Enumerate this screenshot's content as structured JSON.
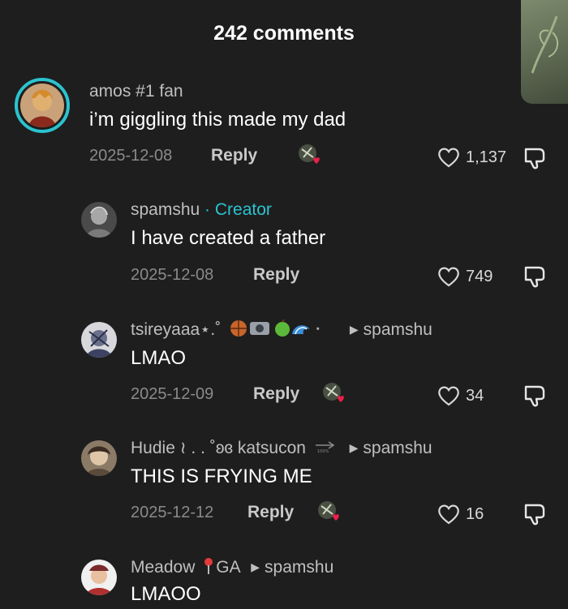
{
  "header": {
    "title": "242 comments"
  },
  "comments": [
    {
      "username": "amos #1 fan",
      "text": "i’m giggling this made my dad",
      "date": "2025-12-08",
      "reply_label": "Reply",
      "likes": "1,137"
    },
    {
      "username": "spamshu",
      "creator_sep": " · ",
      "creator_label": "Creator",
      "text": "I have created a father",
      "date": "2025-12-08",
      "reply_label": "Reply",
      "likes": "749"
    },
    {
      "username": "tsireyaaa⋆.˚",
      "reply_to": "spamshu",
      "text": "LMAO",
      "date": "2025-12-09",
      "reply_label": "Reply",
      "likes": "34"
    },
    {
      "username": "Hudie ≀ . . ˚ʚɞ katsucon",
      "reply_to": "spamshu",
      "text": "THIS IS FRYING ME",
      "date": "2025-12-12",
      "reply_label": "Reply",
      "likes": "16"
    },
    {
      "username": "Meadow",
      "location_tag": "GA",
      "reply_to": "spamshu",
      "text": "LMAOO"
    }
  ],
  "colors": {
    "background": "#1e1e1e",
    "creator_accent": "#2bc3cf",
    "heart_sticker": "#e8214a"
  }
}
